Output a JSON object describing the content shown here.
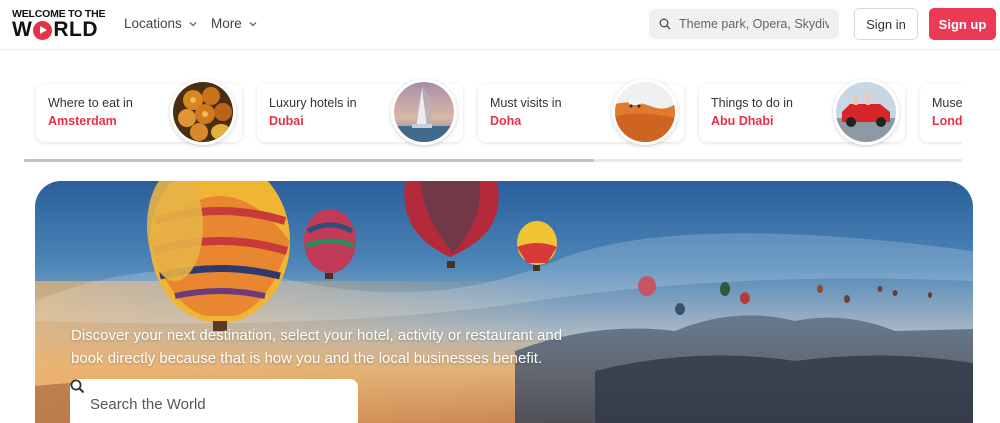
{
  "header": {
    "logo_top": "WELCOME TO THE",
    "logo_bottom_left": "W",
    "logo_bottom_right": "RLD",
    "nav": [
      {
        "label": "Locations"
      },
      {
        "label": "More"
      }
    ],
    "search_placeholder": "Theme park, Opera, Skydive",
    "signin_label": "Sign in",
    "signup_label": "Sign up"
  },
  "categories": [
    {
      "label": "Where to eat in",
      "city": "Amsterdam",
      "image": "food-thumbnail"
    },
    {
      "label": "Luxury hotels in",
      "city": "Dubai",
      "image": "burj-al-arab-thumbnail"
    },
    {
      "label": "Must visits in",
      "city": "Doha",
      "image": "desert-dunes-thumbnail"
    },
    {
      "label": "Things to do in",
      "city": "Abu Dhabi",
      "image": "red-car-thumbnail"
    },
    {
      "label": "Museums in",
      "city": "London",
      "image": "museum-thumbnail"
    }
  ],
  "hero": {
    "text": "Discover your next destination, select your hotel, activity or restaurant and book directly because that is how you and the local businesses benefit.",
    "search_placeholder": "Search the World"
  },
  "colors": {
    "accent": "#e8304a",
    "signup_bg": "#ec3a55"
  }
}
